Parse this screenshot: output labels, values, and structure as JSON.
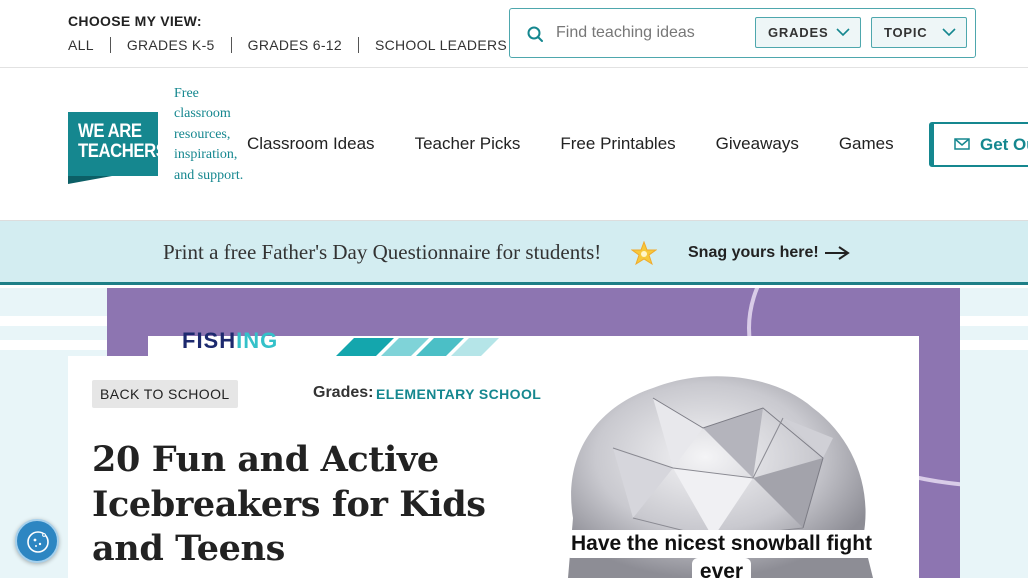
{
  "topbar": {
    "view_title": "CHOOSE MY VIEW:",
    "view_links": [
      "ALL",
      "GRADES K-5",
      "GRADES 6-12",
      "SCHOOL LEADERS"
    ],
    "search": {
      "placeholder": "Find teaching ideas",
      "icon": "search-icon"
    },
    "filters": {
      "grades": "GRADES",
      "topic": "TOPIC"
    }
  },
  "header": {
    "logo_line1": "WE ARE",
    "logo_line2": "TEACHERS",
    "tagline": "Free classroom resources, inspiration, and support.",
    "nav": [
      "Classroom Ideas",
      "Teacher Picks",
      "Free Printables",
      "Giveaways",
      "Games"
    ],
    "cta_label": "Get Our",
    "cta_icon": "envelope-icon"
  },
  "banner": {
    "text": "Print a free Father's Day Questionnaire for students!",
    "link": "Snag yours here!",
    "icons": [
      "star-sparkle-icon",
      "arrow-right-icon"
    ]
  },
  "article": {
    "tag": "BACK TO SCHOOL",
    "grades_label": "Grades:",
    "grades_value": "ELEMENTARY SCHOOL",
    "title": "20 Fun and Active Icebreakers for Kids and Teens",
    "photo_caption_line1": "Have the nicest snowball fight",
    "photo_caption_line2": "ever"
  },
  "hero": {
    "partial_text_a": "FISH",
    "partial_text_b": "ING"
  },
  "colors": {
    "brand_teal": "#15878f",
    "hero_purple": "#8d75b1",
    "banner_bg": "#d3edf1"
  }
}
